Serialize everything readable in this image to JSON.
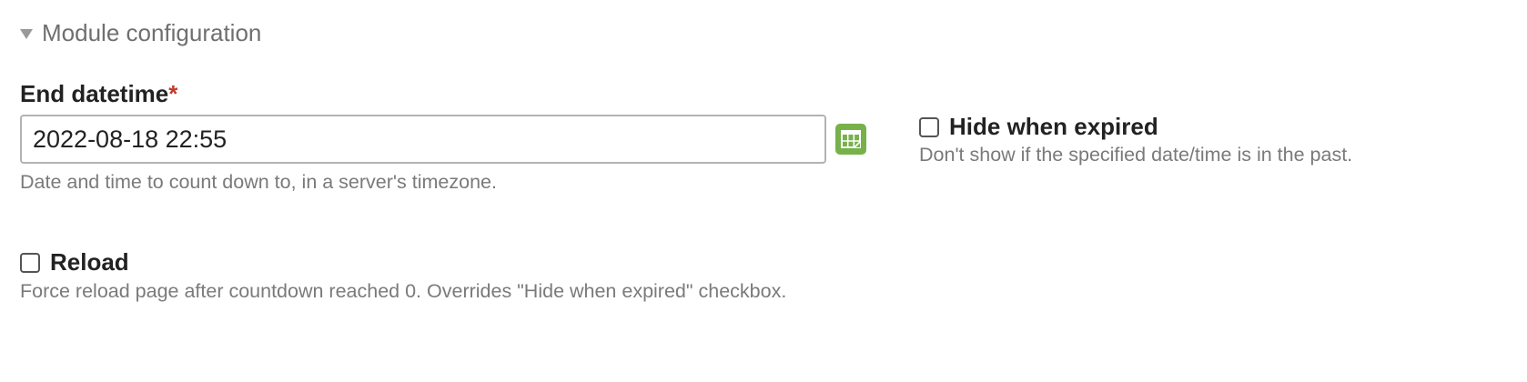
{
  "section": {
    "title": "Module configuration",
    "expanded": true
  },
  "end_datetime": {
    "label": "End datetime",
    "required_marker": "*",
    "value": "2022-08-18 22:55",
    "help": "Date and time to count down to, in a server's timezone.",
    "calendar_icon": "calendar-icon",
    "calendar_button_color": "#77b14a"
  },
  "hide_when_expired": {
    "label": "Hide when expired",
    "checked": false,
    "help": "Don't show if the specified date/time is in the past."
  },
  "reload": {
    "label": "Reload",
    "checked": false,
    "help": "Force reload page after countdown reached 0. Overrides \"Hide when expired\" checkbox."
  },
  "colors": {
    "required": "#c0392b",
    "help_text": "#7a7a7a",
    "section_title": "#6f6f6f"
  }
}
